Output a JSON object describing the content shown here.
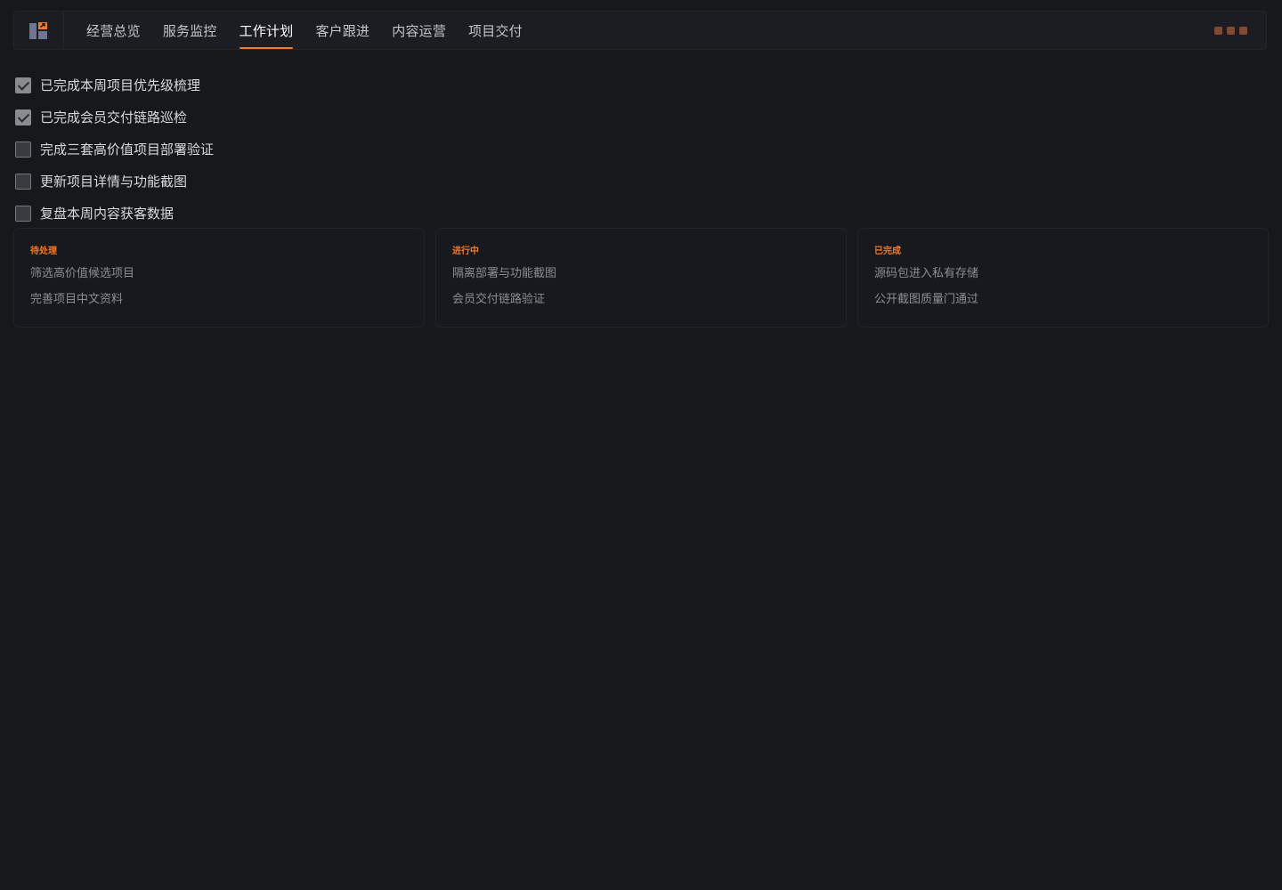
{
  "header": {
    "logo_icon": "kanban-logo-icon",
    "tabs": [
      {
        "label": "经营总览",
        "active": false
      },
      {
        "label": "服务监控",
        "active": false
      },
      {
        "label": "工作计划",
        "active": true
      },
      {
        "label": "客户跟进",
        "active": false
      },
      {
        "label": "内容运营",
        "active": false
      },
      {
        "label": "项目交付",
        "active": false
      }
    ],
    "window_controls": [
      "window-control-icon",
      "window-control-icon",
      "window-control-icon"
    ]
  },
  "todos": [
    {
      "label": "已完成本周项目优先级梳理",
      "checked": true
    },
    {
      "label": "已完成会员交付链路巡检",
      "checked": true
    },
    {
      "label": "完成三套高价值项目部署验证",
      "checked": false
    },
    {
      "label": "更新项目详情与功能截图",
      "checked": false
    },
    {
      "label": "复盘本周内容获客数据",
      "checked": false
    }
  ],
  "boards": [
    {
      "title": "待处理",
      "items": [
        "筛选高价值候选项目",
        "完善项目中文资料"
      ]
    },
    {
      "title": "进行中",
      "items": [
        "隔离部署与功能截图",
        "会员交付链路验证"
      ]
    },
    {
      "title": "已完成",
      "items": [
        "源码包进入私有存储",
        "公开截图质量门通过"
      ]
    }
  ],
  "colors": {
    "background": "#17181c",
    "accent": "#f07a2d",
    "text": "#d7d9de",
    "muted_text": "#8b8e96"
  }
}
